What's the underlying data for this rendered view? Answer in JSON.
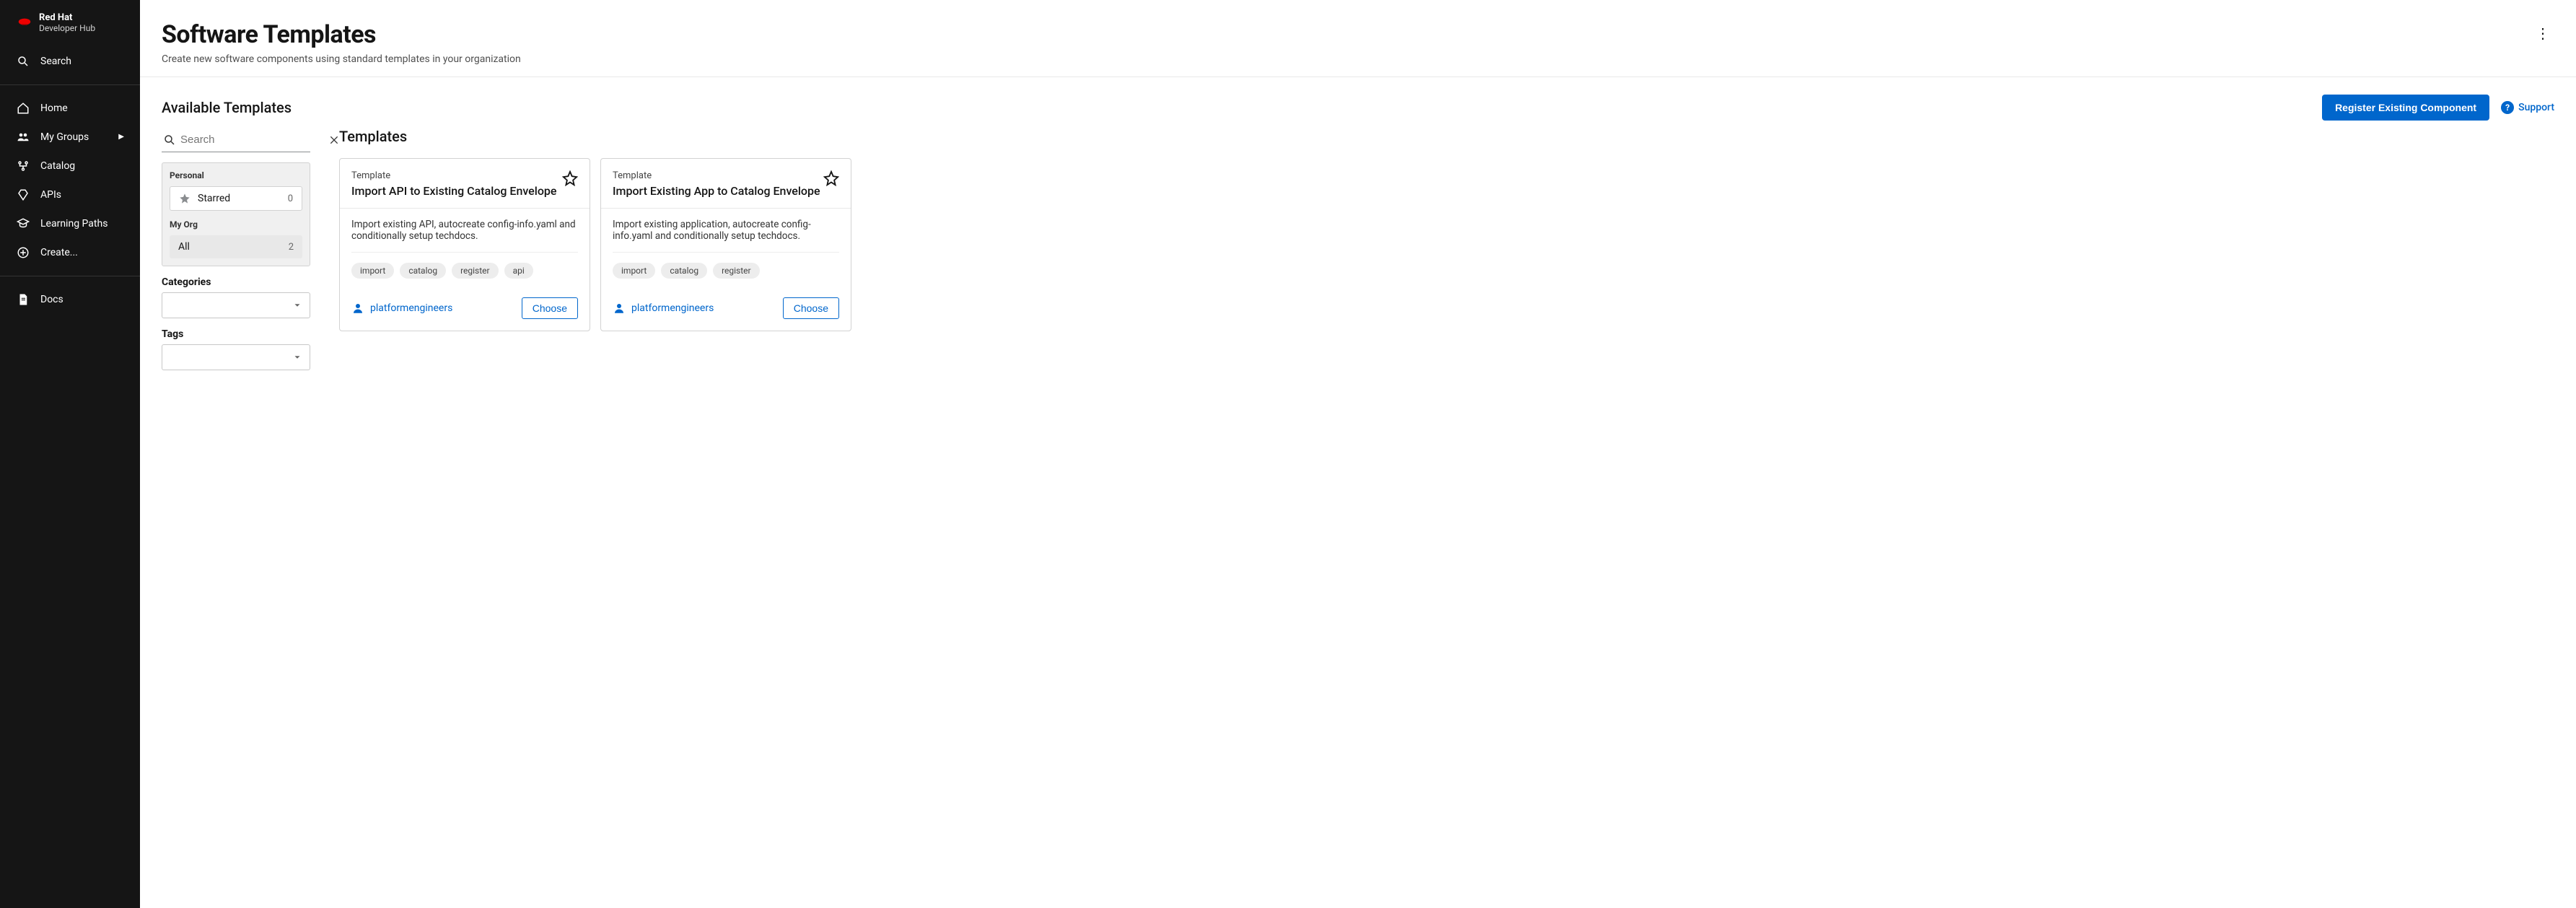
{
  "brand": {
    "line1": "Red Hat",
    "line2": "Developer Hub"
  },
  "nav": {
    "search": "Search",
    "items": [
      {
        "label": "Home",
        "icon": "home-icon"
      },
      {
        "label": "My Groups",
        "icon": "groups-icon",
        "chevron": true
      },
      {
        "label": "Catalog",
        "icon": "catalog-icon"
      },
      {
        "label": "APIs",
        "icon": "apis-icon"
      },
      {
        "label": "Learning Paths",
        "icon": "learning-icon"
      },
      {
        "label": "Create...",
        "icon": "create-icon"
      }
    ],
    "docs": "Docs"
  },
  "header": {
    "title": "Software Templates",
    "subtitle": "Create new software components using standard templates in your organization"
  },
  "toolbar": {
    "heading": "Available Templates",
    "register_label": "Register Existing Component",
    "support_label": "Support"
  },
  "filters": {
    "search_placeholder": "Search",
    "personal_label": "Personal",
    "starred_label": "Starred",
    "starred_count": "0",
    "myorg_label": "My Org",
    "all_label": "All",
    "all_count": "2",
    "categories_label": "Categories",
    "tags_label": "Tags"
  },
  "templates": {
    "heading": "Templates",
    "cards": [
      {
        "type": "Template",
        "title": "Import API to Existing Catalog Envelope",
        "description": "Import existing API, autocreate config-info.yaml and conditionally setup techdocs.",
        "tags": [
          "import",
          "catalog",
          "register",
          "api"
        ],
        "owner": "platformengineers",
        "choose": "Choose"
      },
      {
        "type": "Template",
        "title": "Import Existing App to Catalog Envelope",
        "description": "Import existing application, autocreate config-info.yaml and conditionally setup techdocs.",
        "tags": [
          "import",
          "catalog",
          "register"
        ],
        "owner": "platformengineers",
        "choose": "Choose"
      }
    ]
  },
  "colors": {
    "primary": "#0066cc",
    "sidebar": "#151515"
  }
}
